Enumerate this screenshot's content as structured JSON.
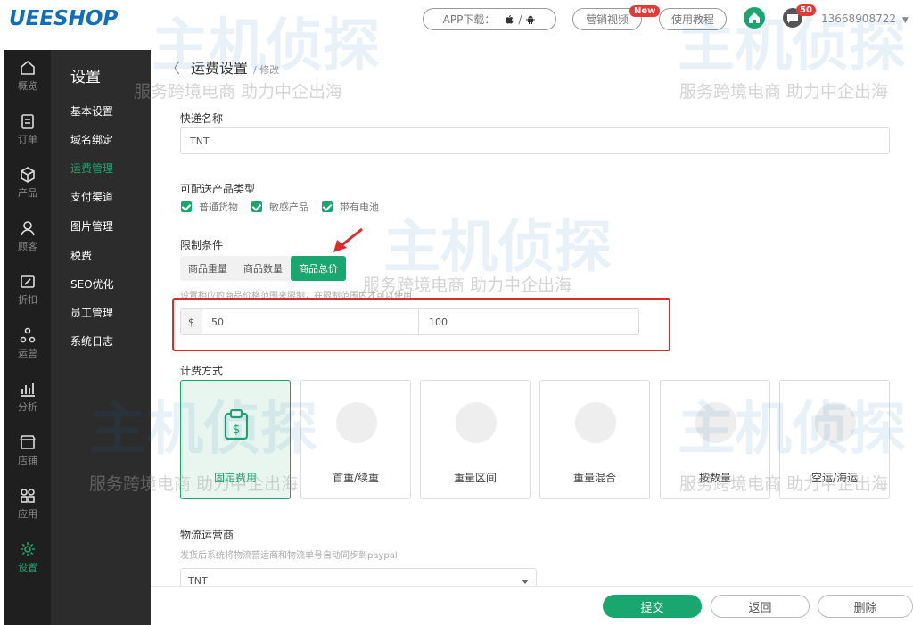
{
  "brand": {
    "logo": "UEESHOP",
    "accent": "#1aa66f",
    "logo_color": "#0f6fbe"
  },
  "header": {
    "app_download": "APP下载：",
    "app_icons": [
      "apple-icon",
      "android-icon"
    ],
    "app_sep": "/",
    "marketing_video": "营销视频",
    "new_badge": "New",
    "tutorial": "使用教程",
    "message_count": "50",
    "phone": "13668908722"
  },
  "icon_rail": [
    {
      "label": "概览",
      "icon": "home-icon"
    },
    {
      "label": "订单",
      "icon": "order-icon"
    },
    {
      "label": "产品",
      "icon": "product-icon"
    },
    {
      "label": "顾客",
      "icon": "customer-icon"
    },
    {
      "label": "折扣",
      "icon": "discount-icon"
    },
    {
      "label": "运营",
      "icon": "operation-icon"
    },
    {
      "label": "分析",
      "icon": "analysis-icon"
    },
    {
      "label": "店铺",
      "icon": "store-icon"
    },
    {
      "label": "应用",
      "icon": "app-icon"
    },
    {
      "label": "设置",
      "icon": "gear-icon"
    }
  ],
  "submenu": {
    "title": "设置",
    "items": [
      "基本设置",
      "域名绑定",
      "运费管理",
      "支付渠道",
      "图片管理",
      "税费",
      "SEO优化",
      "员工管理",
      "系统日志"
    ]
  },
  "page": {
    "back": "〈",
    "title": "运费设置",
    "sub": "/ 修改"
  },
  "form": {
    "name_label": "快递名称",
    "name_value": "TNT",
    "types_label": "可配送产品类型",
    "types": [
      "普通货物",
      "敏感产品",
      "带有电池"
    ],
    "limit_label": "限制条件",
    "limit_tabs": [
      "商品重量",
      "商品数量",
      "商品总价"
    ],
    "limit_hint": "设置相应的商品价格范围来限制，在限制范围内才可以使用",
    "currency": "$",
    "min": "50",
    "max": "100",
    "fee_label": "计费方式",
    "fee_cards": [
      "固定费用",
      "首重/续重",
      "重量区间",
      "重量混合",
      "按数量",
      "空运/海运"
    ],
    "carrier_label": "物流运营商",
    "carrier_hint": "发货后系统将物流营运商和物流单号自动同步到paypal",
    "carrier_value": "TNT"
  },
  "footer": {
    "submit": "提交",
    "back": "返回",
    "delete": "删除"
  },
  "watermark": {
    "big": "主机侦探",
    "small": "服务跨境电商 助力中企出海"
  }
}
